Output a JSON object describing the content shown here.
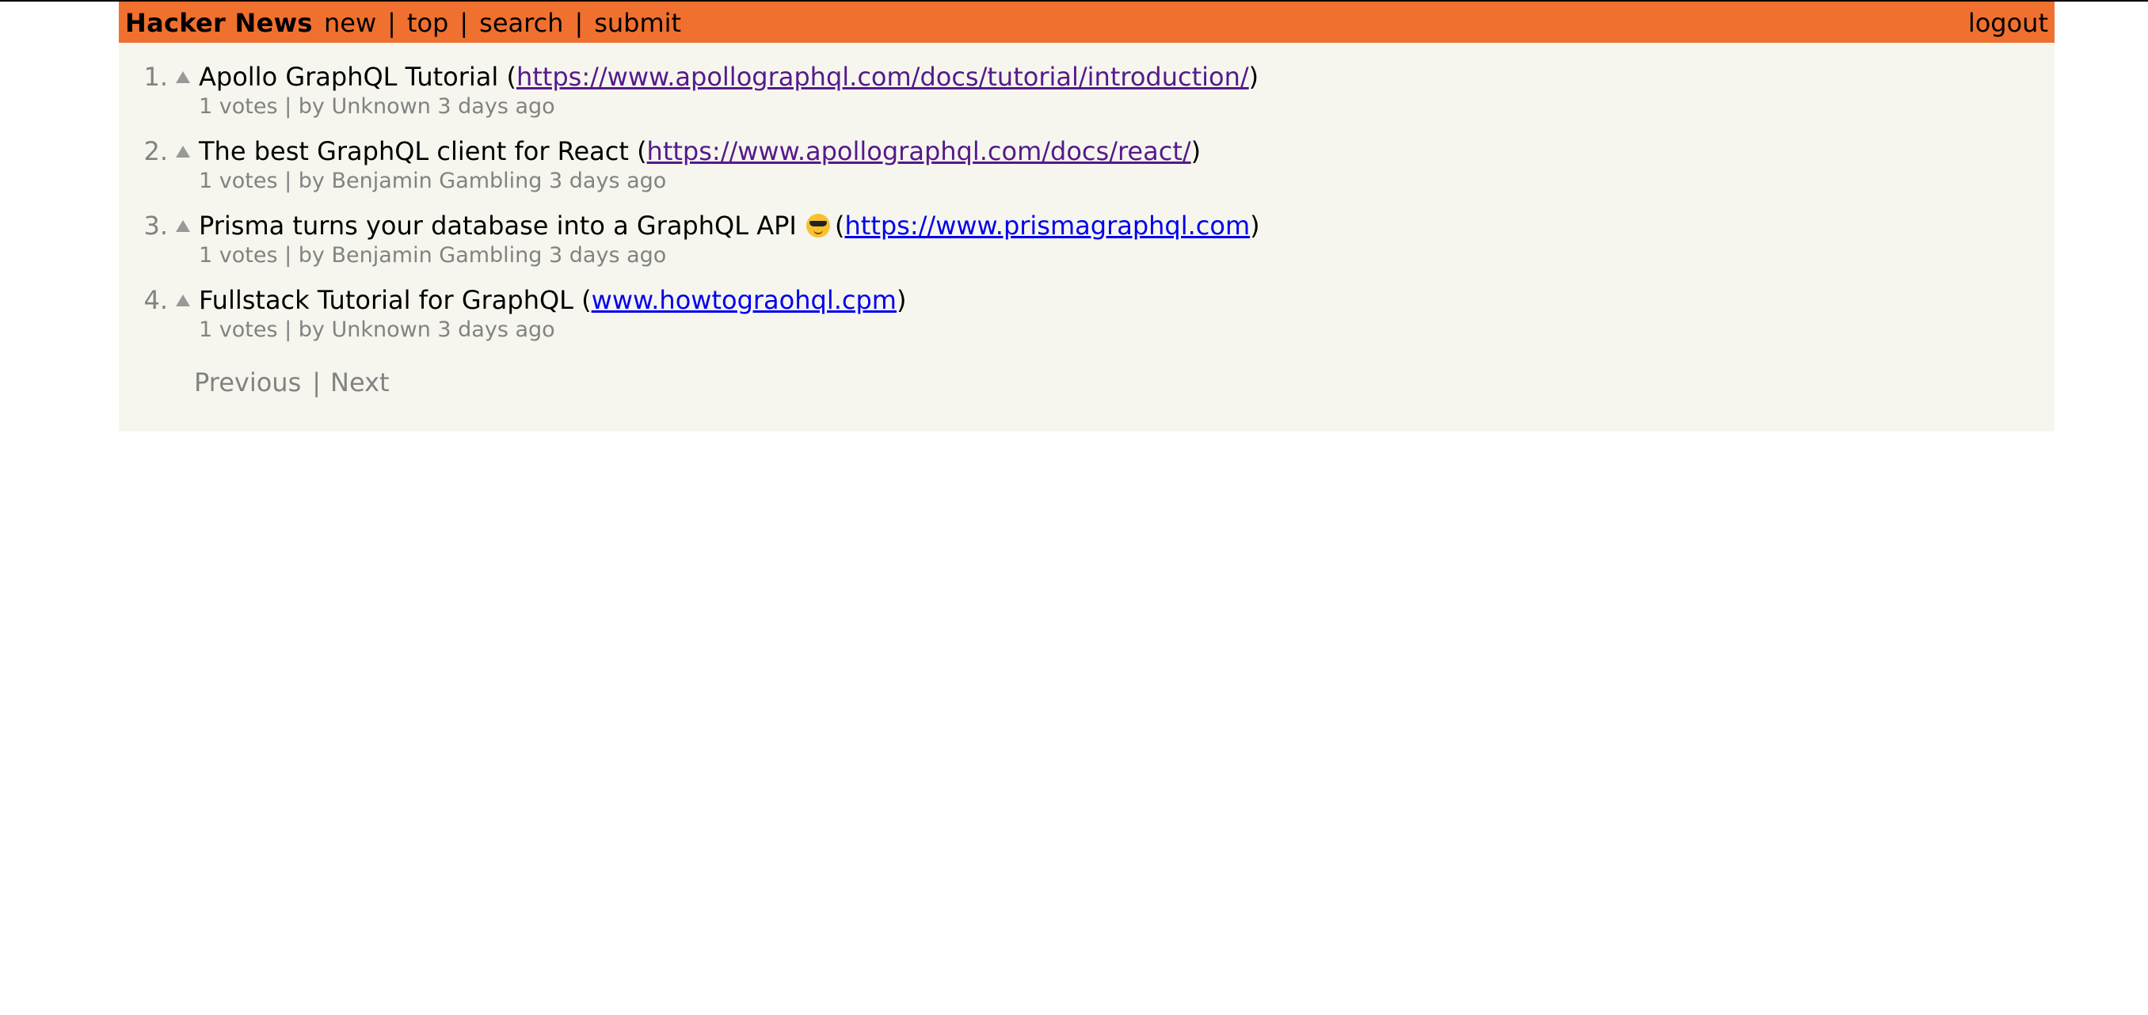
{
  "header": {
    "brand": "Hacker News",
    "nav": [
      "new",
      "top",
      "search",
      "submit"
    ],
    "separator": "|",
    "logout": "logout",
    "colors": {
      "bar": "#f0702f",
      "background": "#f6f6ef"
    }
  },
  "items": [
    {
      "rank": "1.",
      "title": "Apollo GraphQL Tutorial",
      "url": "https://www.apollographql.com/docs/tutorial/introduction/",
      "meta": "1 votes | by Unknown 3 days ago"
    },
    {
      "rank": "2.",
      "title": "The best GraphQL client for React",
      "url": "https://www.apollographql.com/docs/react/",
      "meta": "1 votes | by Benjamin Gambling 3 days ago"
    },
    {
      "rank": "3.",
      "title": "Prisma turns your database into a GraphQL API",
      "emoji": "smiling-face-with-sunglasses-icon",
      "url": "https://www.prismagraphql.com",
      "meta": "1 votes | by Benjamin Gambling 3 days ago"
    },
    {
      "rank": "4.",
      "title": "Fullstack Tutorial for GraphQL",
      "url": "www.howtograohql.cpm",
      "meta": "1 votes | by Unknown 3 days ago"
    }
  ],
  "pager": {
    "previous": "Previous",
    "separator": "|",
    "next": "Next"
  }
}
